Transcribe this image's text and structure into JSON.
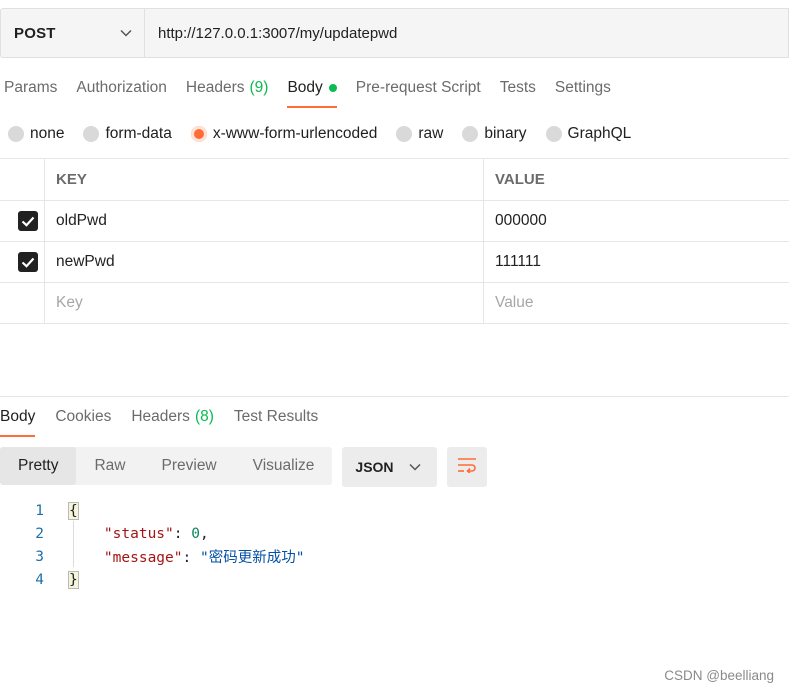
{
  "request": {
    "method": "POST",
    "url": "http://127.0.0.1:3007/my/updatepwd"
  },
  "request_tabs": [
    {
      "label": "Params"
    },
    {
      "label": "Authorization"
    },
    {
      "label": "Headers",
      "count": "(9)"
    },
    {
      "label": "Body",
      "active": true
    },
    {
      "label": "Pre-request Script"
    },
    {
      "label": "Tests"
    },
    {
      "label": "Settings"
    }
  ],
  "body_types": [
    {
      "label": "none"
    },
    {
      "label": "form-data"
    },
    {
      "label": "x-www-form-urlencoded",
      "selected": true
    },
    {
      "label": "raw"
    },
    {
      "label": "binary"
    },
    {
      "label": "GraphQL"
    }
  ],
  "kv_table": {
    "headers": {
      "key": "KEY",
      "value": "VALUE"
    },
    "rows": [
      {
        "key": "oldPwd",
        "value": "000000",
        "checked": true
      },
      {
        "key": "newPwd",
        "value": "111111",
        "checked": true
      }
    ],
    "placeholder": {
      "key": "Key",
      "value": "Value"
    }
  },
  "response_tabs": [
    {
      "label": "Body",
      "active": true
    },
    {
      "label": "Cookies"
    },
    {
      "label": "Headers",
      "count": "(8)"
    },
    {
      "label": "Test Results"
    }
  ],
  "view_modes": [
    {
      "label": "Pretty",
      "active": true
    },
    {
      "label": "Raw"
    },
    {
      "label": "Preview"
    },
    {
      "label": "Visualize"
    }
  ],
  "format": "JSON",
  "response_lines": [
    {
      "num": "1",
      "open": "{"
    },
    {
      "num": "2",
      "key": "\"status\"",
      "sep": ": ",
      "value": "0",
      "trail": ","
    },
    {
      "num": "3",
      "key": "\"message\"",
      "sep": ": ",
      "value": "\"密码更新成功\"",
      "trail": ""
    },
    {
      "num": "4",
      "close": "}"
    }
  ],
  "watermark": "CSDN @beelliang",
  "colors": {
    "accent": "#ff6c37",
    "count": "#0cbb52"
  }
}
